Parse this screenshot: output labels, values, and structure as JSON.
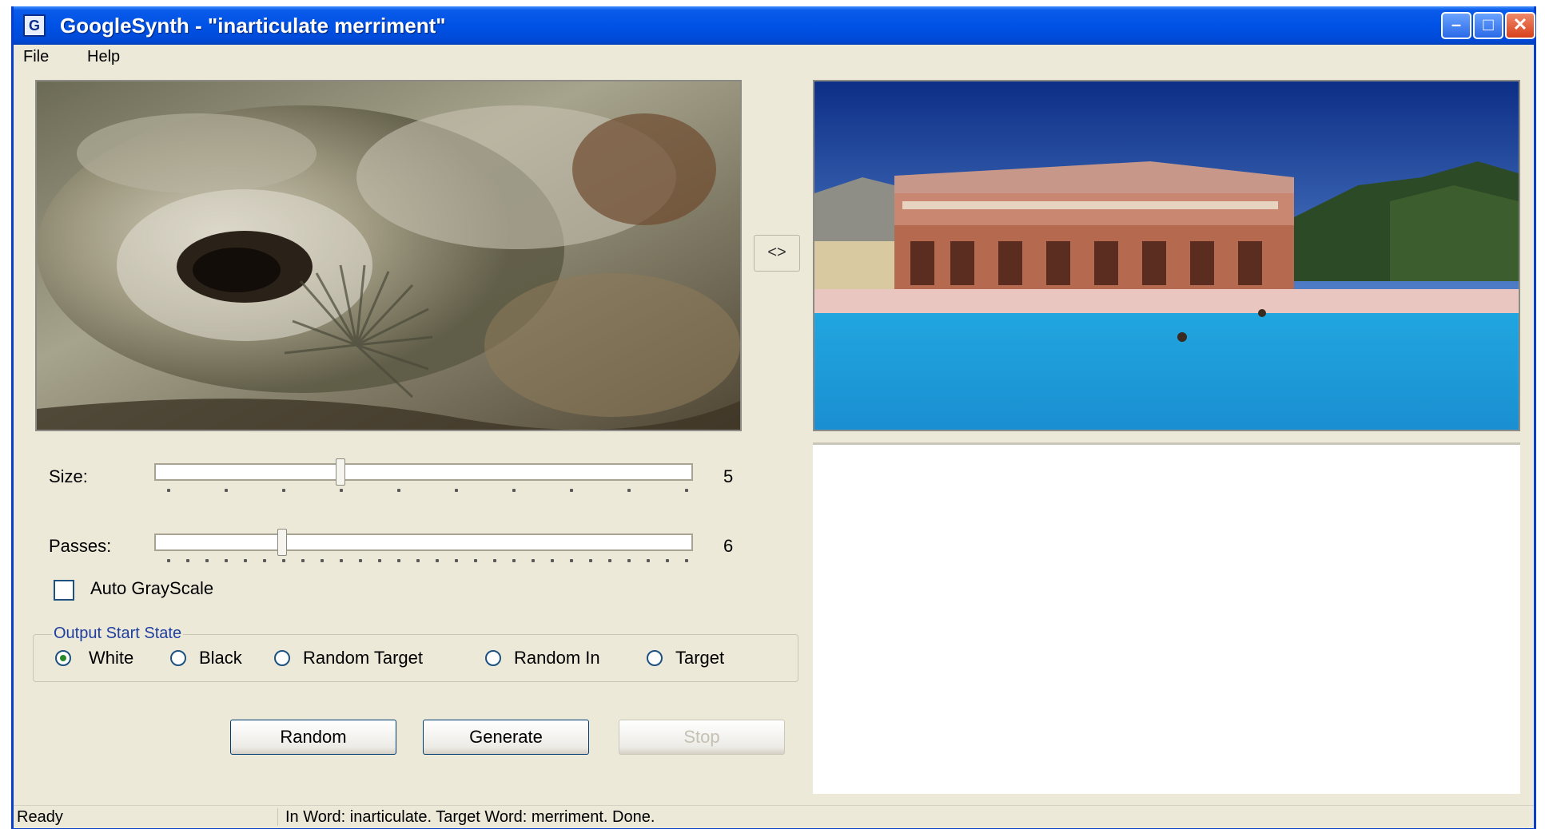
{
  "window": {
    "title": "GoogleSynth - \"inarticulate merriment\"",
    "buttons": {
      "minimize": "–",
      "maximize": "□",
      "close": "✕"
    }
  },
  "menu": [
    "File",
    "Help"
  ],
  "swap_label": "<>",
  "size_slider": {
    "label": "Size:",
    "value": "5",
    "level": 0.34
  },
  "passes_slider": {
    "label": "Passes:",
    "value": "6",
    "level": 0.23
  },
  "auto_grayscale": {
    "label": "Auto GrayScale",
    "checked": false
  },
  "output_start_state": {
    "title": "Output Start State",
    "options": [
      {
        "label": "White",
        "checked": true
      },
      {
        "label": "Black",
        "checked": false
      },
      {
        "label": "Random Target",
        "checked": false
      },
      {
        "label": "Random In",
        "checked": false
      },
      {
        "label": "Target",
        "checked": false
      }
    ]
  },
  "buttons": {
    "random": "Random",
    "generate": "Generate",
    "stop": "Stop"
  },
  "status": {
    "left": "Ready",
    "right": "In Word: inarticulate. Target Word: merriment. Done."
  },
  "icons": {
    "app": "app-icon",
    "minimize": "minimize-icon",
    "maximize": "maximize-icon",
    "close": "close-icon"
  },
  "colors": {
    "titlebar": "#0052e6",
    "window_bg": "#ece9d8"
  }
}
